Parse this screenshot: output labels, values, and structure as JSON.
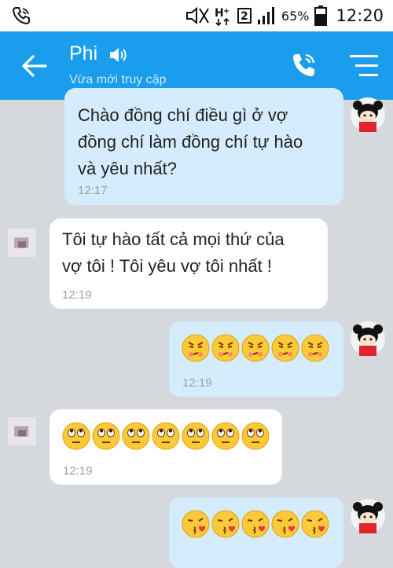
{
  "status_bar": {
    "battery": "65%",
    "time": "12:20",
    "sim": "2"
  },
  "header": {
    "title": "Phi",
    "subtitle": "Vừa mới truy cập"
  },
  "messages": [
    {
      "from": "me",
      "text": "Chào đồng chí điều gì ở vợ đồng chí làm đồng chí tự hào và yêu nhất?",
      "lines": [
        "Chào đồng chí điều gì ở vợ",
        "đồng chí làm đồng chí tự hào",
        "và yêu nhất?"
      ],
      "time": "12:17"
    },
    {
      "from": "them",
      "text": "Tôi tự hào tất cả mọi thứ của vợ tôi ! Tôi yêu vợ tôi nhất !",
      "lines": [
        "Tôi tự hào tất cả mọi thứ của",
        "vợ tôi ! Tôi yêu vợ tôi nhất !"
      ],
      "time": "12:19"
    },
    {
      "from": "me",
      "emoji": "pouting-face",
      "emoji_count": 5,
      "time": "12:19"
    },
    {
      "from": "them",
      "emoji": "rolling-eyes-face",
      "emoji_count": 7,
      "time": "12:19"
    },
    {
      "from": "me",
      "emoji": "kissing-heart-face",
      "emoji_count": 5
    }
  ],
  "colors": {
    "app_bar": "#1a9ded",
    "my_bubble": "#d4ecfb",
    "their_bubble": "#ffffff",
    "background": "#d5d9de"
  },
  "icons": [
    "phone-status-icon",
    "signal-icon",
    "battery-icon",
    "back-arrow-icon",
    "speaker-icon",
    "call-icon",
    "menu-icon"
  ]
}
